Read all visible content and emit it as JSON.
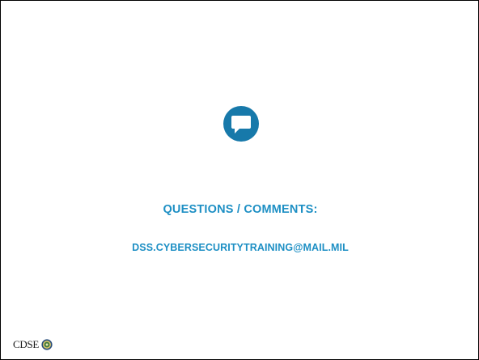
{
  "slide": {
    "heading": "QUESTIONS / COMMENTS:",
    "email": "DSS.CYBERSECURITYTRAINING@MAIL.MIL",
    "footer_logo_text": "CDSE"
  },
  "icons": {
    "main": "chat-bubble-icon",
    "footer": "cdse-seal-icon"
  },
  "colors": {
    "accent": "#1d8fc4",
    "icon_fill": "#1779aa",
    "border": "#000000",
    "background": "#ffffff"
  }
}
